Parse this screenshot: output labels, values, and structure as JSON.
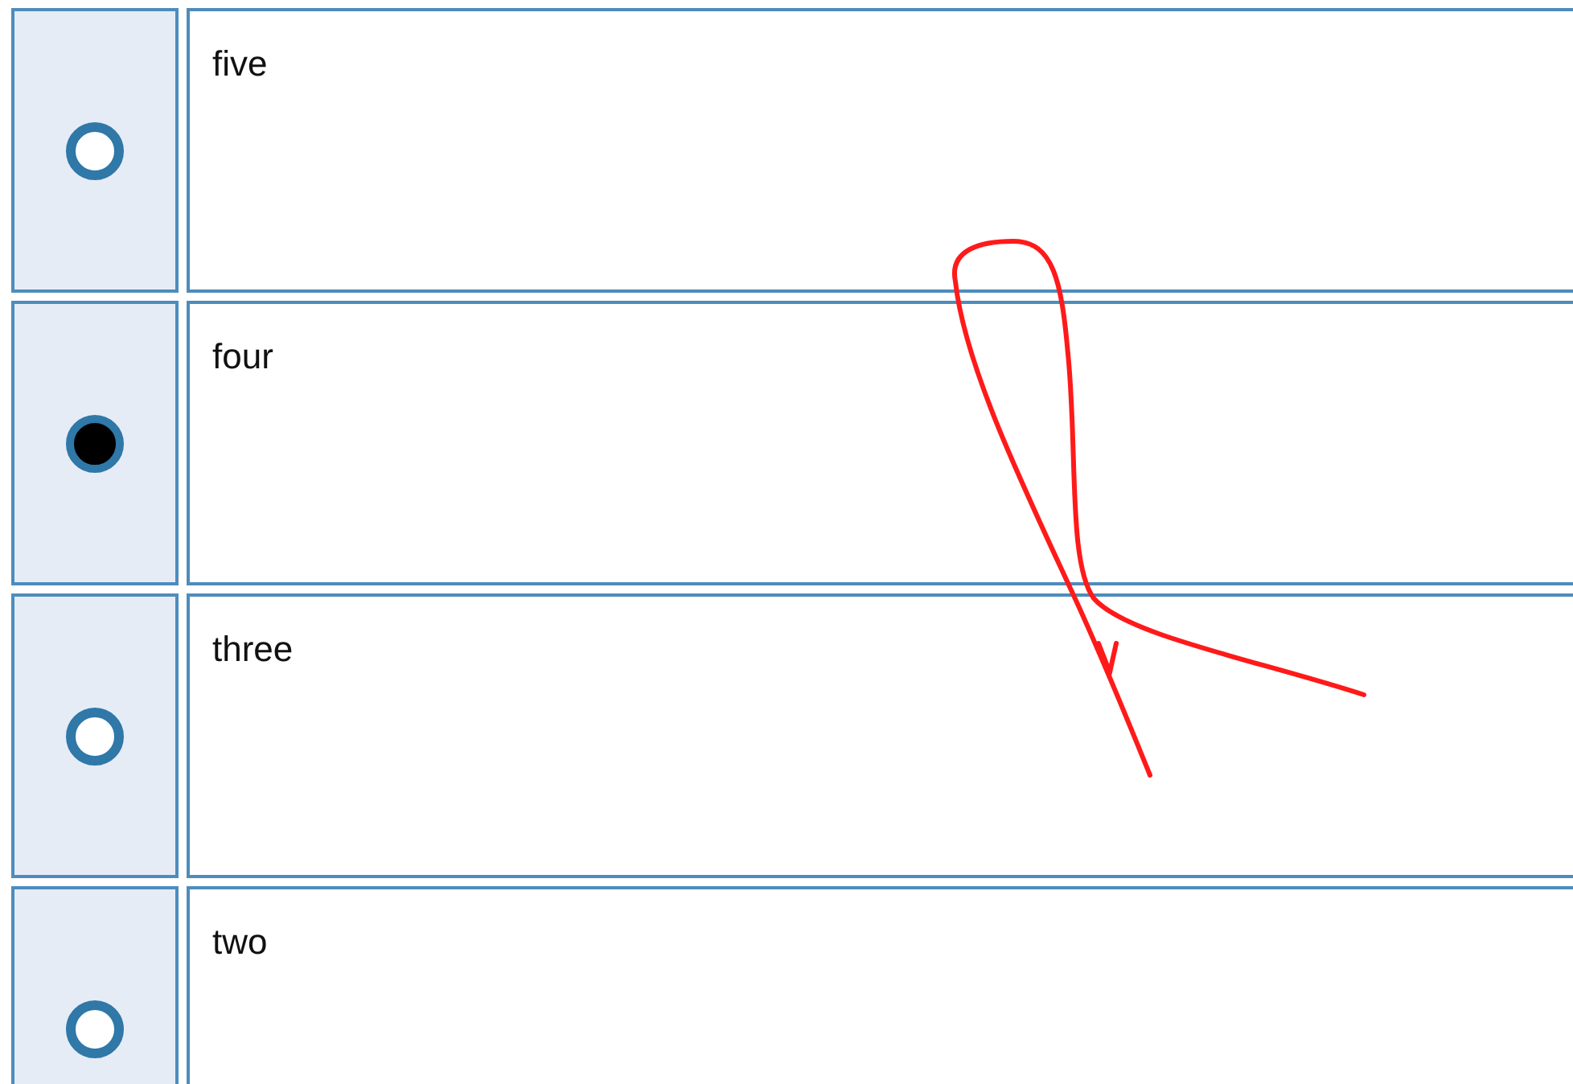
{
  "options": [
    {
      "label": "five",
      "selected": false
    },
    {
      "label": "four",
      "selected": true
    },
    {
      "label": "three",
      "selected": false
    },
    {
      "label": "two",
      "selected": false
    }
  ]
}
